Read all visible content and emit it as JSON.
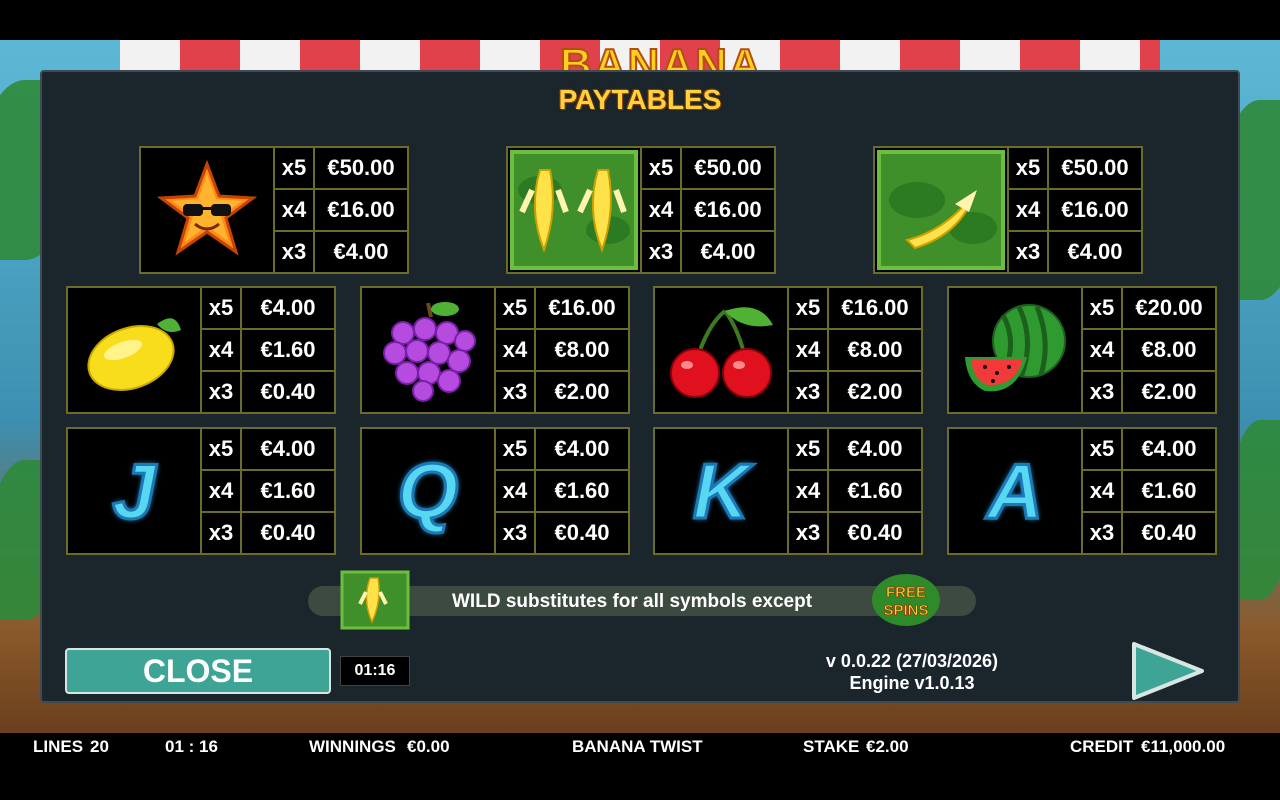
{
  "game": {
    "name": "BANANA TWIST",
    "logo_text": "BANANA"
  },
  "paytable": {
    "heading": "PAYTABLES",
    "top_row": [
      {
        "symbol": "star-sunglasses",
        "pays": [
          [
            "x5",
            "€50.00"
          ],
          [
            "x4",
            "€16.00"
          ],
          [
            "x3",
            "€4.00"
          ]
        ]
      },
      {
        "symbol": "double-banana",
        "pays": [
          [
            "x5",
            "€50.00"
          ],
          [
            "x4",
            "€16.00"
          ],
          [
            "x3",
            "€4.00"
          ]
        ]
      },
      {
        "symbol": "single-banana",
        "pays": [
          [
            "x5",
            "€50.00"
          ],
          [
            "x4",
            "€16.00"
          ],
          [
            "x3",
            "€4.00"
          ]
        ]
      }
    ],
    "fruit_row": [
      {
        "symbol": "lemon",
        "pays": [
          [
            "x5",
            "€4.00"
          ],
          [
            "x4",
            "€1.60"
          ],
          [
            "x3",
            "€0.40"
          ]
        ]
      },
      {
        "symbol": "grapes",
        "pays": [
          [
            "x5",
            "€16.00"
          ],
          [
            "x4",
            "€8.00"
          ],
          [
            "x3",
            "€2.00"
          ]
        ]
      },
      {
        "symbol": "cherries",
        "pays": [
          [
            "x5",
            "€16.00"
          ],
          [
            "x4",
            "€8.00"
          ],
          [
            "x3",
            "€2.00"
          ]
        ]
      },
      {
        "symbol": "watermelon",
        "pays": [
          [
            "x5",
            "€20.00"
          ],
          [
            "x4",
            "€8.00"
          ],
          [
            "x3",
            "€2.00"
          ]
        ]
      }
    ],
    "letter_row": [
      {
        "symbol": "J",
        "pays": [
          [
            "x5",
            "€4.00"
          ],
          [
            "x4",
            "€1.60"
          ],
          [
            "x3",
            "€0.40"
          ]
        ]
      },
      {
        "symbol": "Q",
        "pays": [
          [
            "x5",
            "€4.00"
          ],
          [
            "x4",
            "€1.60"
          ],
          [
            "x3",
            "€0.40"
          ]
        ]
      },
      {
        "symbol": "K",
        "pays": [
          [
            "x5",
            "€4.00"
          ],
          [
            "x4",
            "€1.60"
          ],
          [
            "x3",
            "€0.40"
          ]
        ]
      },
      {
        "symbol": "A",
        "pays": [
          [
            "x5",
            "€4.00"
          ],
          [
            "x4",
            "€1.60"
          ],
          [
            "x3",
            "€0.40"
          ]
        ]
      }
    ],
    "wild_text": "WILD substitutes for all symbols except",
    "free_spins_icon": {
      "line1": "FREE",
      "line2": "SPINS"
    }
  },
  "controls": {
    "close_label": "CLOSE",
    "timer": "01:16",
    "version": "v 0.0.22 (27/03/2026)",
    "engine": "Engine v1.0.13"
  },
  "status_bar": {
    "lines_label": "LINES",
    "lines_value": "20",
    "clock": "01 : 16",
    "winnings_label": "WINNINGS",
    "winnings_value": "€0.00",
    "game_title": "BANANA TWIST",
    "stake_label": "STAKE",
    "stake_value": "€2.00",
    "credit_label": "CREDIT",
    "credit_value": "€11,000.00"
  },
  "colors": {
    "accent": "#ffd23d",
    "close_button": "#3ea596",
    "panel": "#1b252c",
    "grid_border": "#6b6b2a"
  }
}
